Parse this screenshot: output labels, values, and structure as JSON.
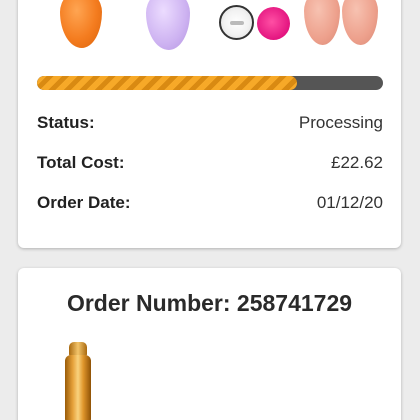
{
  "products": [
    {
      "name": "orange-sponge",
      "color": "#f47c1f"
    },
    {
      "name": "lilac-sponge",
      "color": "#cdb2f1"
    },
    {
      "name": "cleansing-pad-white",
      "color": "#f2f2f2"
    },
    {
      "name": "cleansing-pad-pink",
      "color": "#e3147f"
    },
    {
      "name": "peach-sponge",
      "color": "#eda08c"
    },
    {
      "name": "peach-sponge",
      "color": "#eda08c"
    }
  ],
  "progress": {
    "fraction": 0.75,
    "fill_color": "#f7a928",
    "track_color": "#555555"
  },
  "order_summary": {
    "status_label": "Status:",
    "status_value": "Processing",
    "total_label": "Total Cost:",
    "total_value": "£22.62",
    "date_label": "Order Date:",
    "date_value": "01/12/20"
  },
  "next_order": {
    "title": "Order Number: 258741729",
    "product": {
      "name": "gold-serum-bottle",
      "color": "#e6a13a"
    }
  }
}
